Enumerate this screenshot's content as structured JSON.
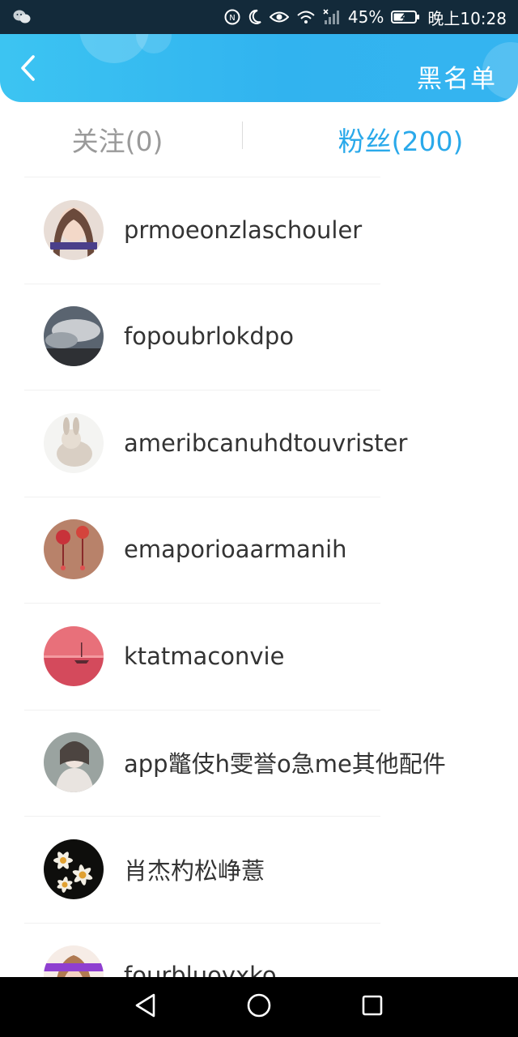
{
  "status_bar": {
    "battery": "45%",
    "time": "晚上10:28",
    "icons": [
      "wechat-icon",
      "nfc-icon",
      "moon-icon",
      "eye-icon",
      "wifi-icon",
      "signal-icon",
      "battery-icon"
    ]
  },
  "header": {
    "back_icon": "chevron-left-icon",
    "action_label": "黑名单",
    "bg_color": "#35b6f0"
  },
  "tabs": [
    {
      "label": "关注(0)",
      "active": false
    },
    {
      "label": "粉丝(200)",
      "active": true
    }
  ],
  "colors": {
    "active_tab": "#2aa9ea",
    "inactive_tab": "#9a9a9a",
    "text": "#333333"
  },
  "fans": [
    {
      "name": "prmoeonzlaschouler",
      "avatar": "girl-portrait-avatar"
    },
    {
      "name": "fopoubrlokdpo",
      "avatar": "cloudy-sky-avatar"
    },
    {
      "name": "ameribcanuhdtouvrister",
      "avatar": "rabbit-avatar"
    },
    {
      "name": "emaporioaarmanih",
      "avatar": "lanterns-avatar"
    },
    {
      "name": "ktatmaconvie",
      "avatar": "pink-sunset-avatar"
    },
    {
      "name": "app鼈伎h雯誉o急me其他配件",
      "avatar": "woman-scarf-avatar"
    },
    {
      "name": "肖杰杓松峥薏",
      "avatar": "daisies-avatar"
    },
    {
      "name": "fourbluoyxko",
      "avatar": "girl-banner-avatar"
    }
  ],
  "nav_bar": [
    "back-triangle-icon",
    "home-circle-icon",
    "recents-square-icon"
  ]
}
